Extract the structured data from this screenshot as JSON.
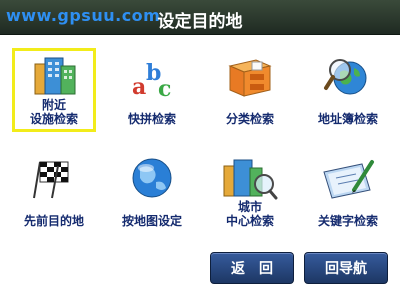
{
  "header": {
    "watermark": "www.gpsuu.com",
    "title": "设定目的地"
  },
  "tiles": [
    {
      "label": "附近\n设施检索",
      "icon": "buildings-icon",
      "selected": true
    },
    {
      "label": "快拼检索",
      "icon": "abc-icon",
      "selected": false
    },
    {
      "label": "分类检索",
      "icon": "drawers-icon",
      "selected": false
    },
    {
      "label": "地址簿检索",
      "icon": "globe-search-icon",
      "selected": false
    },
    {
      "label": "先前目的地",
      "icon": "checkered-flag-icon",
      "selected": false
    },
    {
      "label": "按地图设定",
      "icon": "globe-icon",
      "selected": false
    },
    {
      "label": "城市\n中心检索",
      "icon": "city-search-icon",
      "selected": false
    },
    {
      "label": "关键字检索",
      "icon": "keyword-pen-icon",
      "selected": false
    }
  ],
  "buttons": {
    "back": "返　回",
    "return_nav": "回导航"
  },
  "colors": {
    "title_bar": "#26332a",
    "label_text": "#152b6f",
    "selection_border": "#f2ec1a",
    "button": "#2b4a82",
    "watermark": "#2e8ff2"
  }
}
